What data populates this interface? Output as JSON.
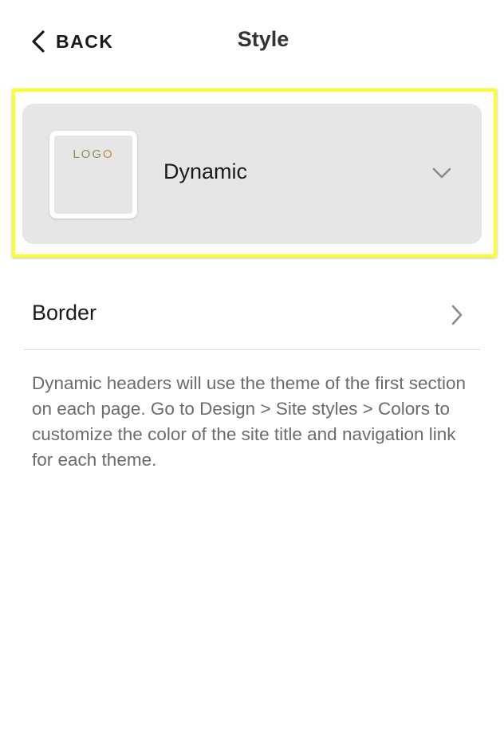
{
  "header": {
    "back_label": "BACK",
    "title": "Style"
  },
  "style_selector": {
    "value": "Dynamic",
    "thumbnail": {
      "logo_letters": [
        {
          "char": "L",
          "color": "#7a9a55"
        },
        {
          "char": "O",
          "color": "#7a9a55"
        },
        {
          "char": "G",
          "color": "#7a9a55"
        },
        {
          "char": "O",
          "color": "#c98a3a"
        }
      ]
    },
    "highlight_color": "#fbff2a",
    "icon": "chevron-down-icon"
  },
  "border_row": {
    "label": "Border",
    "icon": "chevron-right-icon"
  },
  "description": "Dynamic headers will use the theme of the first section on each page. Go to Design > Site styles > Colors to customize the color of the site title and navigation link for each theme."
}
